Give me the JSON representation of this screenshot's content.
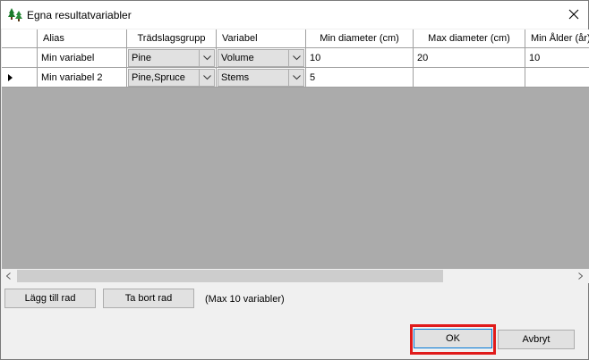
{
  "window": {
    "title": "Egna resultatvariabler",
    "icon": "trees-icon"
  },
  "grid": {
    "columns": [
      "Alias",
      "Trädslagsgrupp",
      "Variabel",
      "Min diameter (cm)",
      "Max diameter (cm)",
      "Min Ålder (år)"
    ],
    "rows": [
      {
        "alias": "Min variabel",
        "tree_group": "Pine",
        "variable": "Volume",
        "min_diameter": "10",
        "max_diameter": "20",
        "min_age": "10",
        "current": false
      },
      {
        "alias": "Min variabel 2",
        "tree_group": "Pine,Spruce",
        "variable": "Stems",
        "min_diameter": "5",
        "max_diameter": "",
        "min_age": "",
        "current": true
      }
    ]
  },
  "buttons": {
    "add_row": "Lägg till rad",
    "remove_row": "Ta bort rad",
    "max_note": "(Max 10 variabler)",
    "ok": "OK",
    "cancel": "Avbryt"
  },
  "colors": {
    "highlight": "#e01b1b",
    "grid_background": "#ababab",
    "button_face": "#e1e1e1"
  }
}
